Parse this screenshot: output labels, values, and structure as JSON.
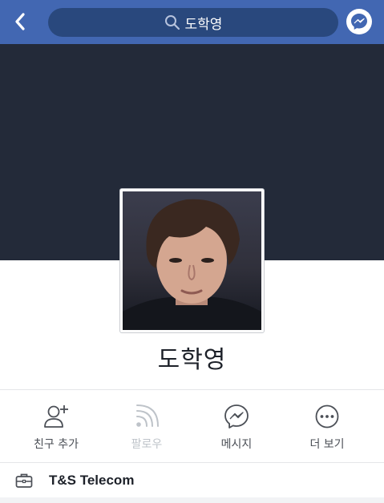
{
  "navbar": {
    "back_icon": "chevron-left-icon",
    "search_icon": "search-icon",
    "search_text": "도학영",
    "messenger_icon": "messenger-icon",
    "bg_color": "#4267b2"
  },
  "profile": {
    "name": "도학영",
    "cover_color": "#232a39"
  },
  "actions": [
    {
      "label": "친구 추가",
      "icon": "add-friend-icon",
      "enabled": true
    },
    {
      "label": "팔로우",
      "icon": "follow-icon",
      "enabled": false
    },
    {
      "label": "메시지",
      "icon": "messenger-icon",
      "enabled": true
    },
    {
      "label": "더 보기",
      "icon": "more-icon",
      "enabled": true
    }
  ],
  "work": {
    "icon": "briefcase-icon",
    "text": "T&S Telecom"
  }
}
